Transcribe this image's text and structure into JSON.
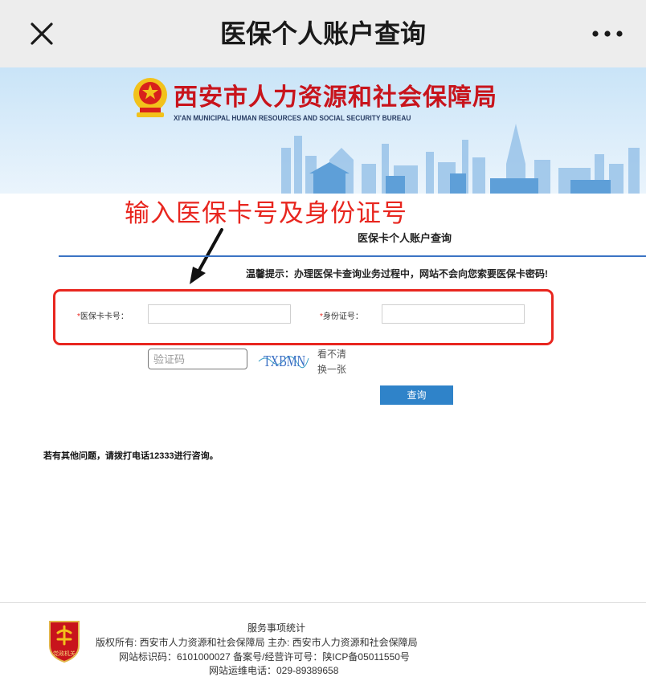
{
  "nav": {
    "title": "医保个人账户查询",
    "close_icon": "close-icon",
    "more_icon": "more-dots-icon"
  },
  "banner": {
    "org_name_cn": "西安市人力资源和社会保障局",
    "org_name_en": "XI'AN MUNICIPAL HUMAN RESOURCES AND SOCIAL SECURITY BUREAU",
    "emblem_icon": "national-emblem-icon"
  },
  "annotation": {
    "text": "输入医保卡号及身份证号",
    "color": "#e8261f"
  },
  "form": {
    "heading": "医保卡个人账户查询",
    "tip": "温馨提示：办理医保卡查询业务过程中，网站不会向您索要医保卡密码!",
    "card_label_req": "*",
    "card_label": "医保卡卡号：",
    "card_value": "",
    "id_label_req": "*",
    "id_label": "身份证号：",
    "id_value": "",
    "captcha_placeholder": "验证码",
    "captcha_image_text": "TXBMN",
    "refresh_line1": "看不清",
    "refresh_line2": "换一张",
    "query_button": "查询"
  },
  "help_text": "若有其他问题，请拨打电话12333进行咨询。",
  "footer": {
    "stats_link": "服务事项统计",
    "copyright": "版权所有:  西安市人力资源和社会保障局   主办:  西安市人力资源和社会保障局",
    "site_id": "网站标识码：6101000027      备案号/经营许可号：陕ICP备05011550号",
    "ops_phone": "网站运维电话：029-89389658",
    "badge_icon": "party-government-badge-icon",
    "badge_text": "党政机关"
  },
  "colors": {
    "accent_blue": "#2f83c9",
    "rule_blue": "#3b74c4",
    "org_red": "#c8141c",
    "annotation_red": "#e8261f"
  }
}
